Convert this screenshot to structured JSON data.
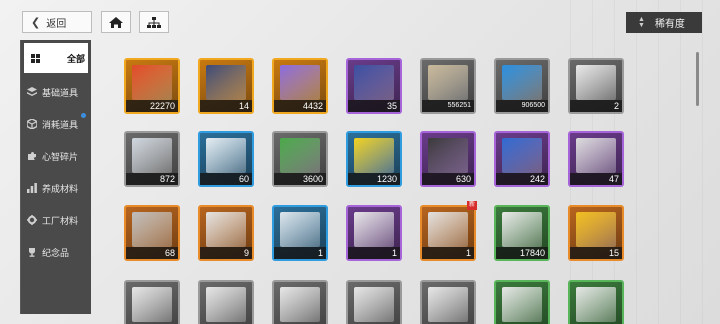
{
  "topbar": {
    "back_label": "返回",
    "home_icon": "home-icon",
    "tree_icon": "hierarchy-icon",
    "sort_label": "稀有度"
  },
  "sidebar": {
    "items": [
      {
        "label": "全部",
        "icon": "grid-icon",
        "active": true
      },
      {
        "label": "基础道具",
        "icon": "layers-icon"
      },
      {
        "label": "消耗道具",
        "icon": "cube-icon",
        "dot": true
      },
      {
        "label": "心智碎片",
        "icon": "puzzle-icon"
      },
      {
        "label": "养成材料",
        "icon": "chart-icon"
      },
      {
        "label": "工厂材料",
        "icon": "gear-icon"
      },
      {
        "label": "纪念品",
        "icon": "trophy-icon"
      }
    ]
  },
  "items": [
    {
      "rarity": "gold",
      "count": "22270",
      "art": "#e04a2a"
    },
    {
      "rarity": "gold",
      "count": "14",
      "art": "#3a4a7a"
    },
    {
      "rarity": "gold",
      "count": "4432",
      "art": "#8a6ae0"
    },
    {
      "rarity": "purple",
      "count": "35",
      "art": "#3a4fa0"
    },
    {
      "rarity": "gray",
      "count": "556251",
      "art": "#c9b99a"
    },
    {
      "rarity": "gray",
      "count": "906500",
      "art": "#2a8fe0"
    },
    {
      "rarity": "gray",
      "count": "2",
      "art": "#e8e8e8"
    },
    {
      "rarity": "gray",
      "count": "872",
      "art": "#cfd6de"
    },
    {
      "rarity": "blue",
      "count": "60",
      "art": "#e6ecf0"
    },
    {
      "rarity": "gray",
      "count": "3600",
      "art": "#4aa84a"
    },
    {
      "rarity": "blue",
      "count": "1230",
      "art": "#f2d020"
    },
    {
      "rarity": "purple",
      "count": "630",
      "art": "#3a3a3a"
    },
    {
      "rarity": "purple",
      "count": "242",
      "art": "#2f6ad0"
    },
    {
      "rarity": "purple",
      "count": "47",
      "art": "#dcdcdc"
    },
    {
      "rarity": "orange",
      "count": "68",
      "art": "#bdbdbd"
    },
    {
      "rarity": "orange",
      "count": "9",
      "art": "#e2e2e2"
    },
    {
      "rarity": "blue",
      "count": "1",
      "art": "#dde4ea"
    },
    {
      "rarity": "purple",
      "count": "1",
      "art": "#e6e6e6"
    },
    {
      "rarity": "orange",
      "count": "1",
      "art": "#e0e0e0",
      "new": "新"
    },
    {
      "rarity": "green",
      "count": "17840",
      "art": "#e8e8e8"
    },
    {
      "rarity": "orange",
      "count": "15",
      "art": "#f0c020"
    },
    {
      "rarity": "gray",
      "count": "",
      "art": "#e6e6e6"
    },
    {
      "rarity": "gray",
      "count": "",
      "art": "#e6e6e6"
    },
    {
      "rarity": "gray",
      "count": "",
      "art": "#e6e6e6"
    },
    {
      "rarity": "gray",
      "count": "",
      "art": "#e6e6e6"
    },
    {
      "rarity": "gray",
      "count": "",
      "art": "#e6e6e6"
    },
    {
      "rarity": "green",
      "count": "",
      "art": "#e6e6e6"
    },
    {
      "rarity": "green",
      "count": "",
      "art": "#e6e6e6"
    }
  ]
}
